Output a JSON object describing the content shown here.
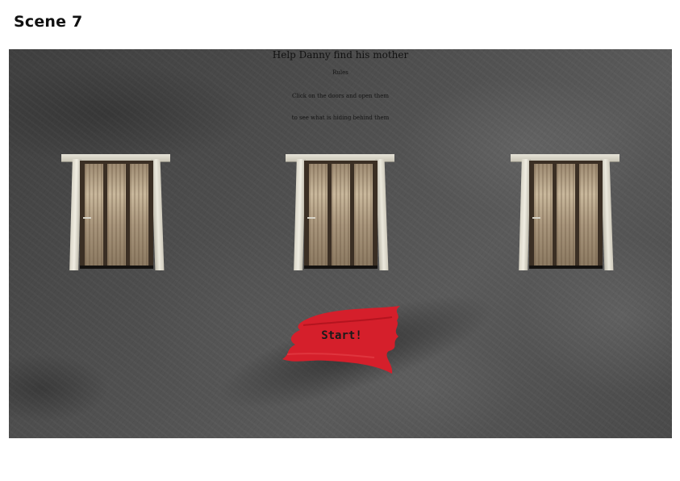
{
  "scene": {
    "label": "Scene 7"
  },
  "game": {
    "title": "Help Danny find his mother",
    "rules_heading": "Rules",
    "rules_lines": [
      "Click on the doors and open them",
      "to see what is hiding behind them"
    ],
    "doors": [
      {
        "name": "door-left"
      },
      {
        "name": "door-center"
      },
      {
        "name": "door-right"
      }
    ],
    "start_button": {
      "label": "Start!",
      "color": "#d51f2b"
    },
    "colors": {
      "background": "#4a4a4a",
      "door_frame": "#e2dfd3",
      "door_wood": "#b8a68a"
    }
  }
}
